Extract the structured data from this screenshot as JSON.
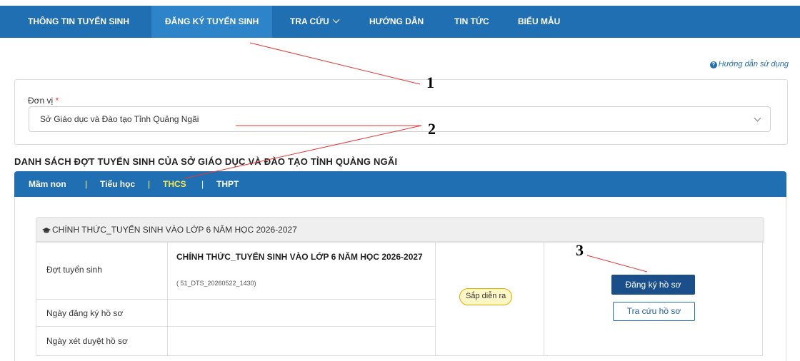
{
  "topnav": {
    "items": [
      {
        "label": "THÔNG TIN TUYỂN SINH"
      },
      {
        "label": "ĐĂNG KÝ TUYỂN SINH"
      },
      {
        "label": "TRA CỨU"
      },
      {
        "label": "HƯỚNG DẪN"
      },
      {
        "label": "TIN TỨC"
      },
      {
        "label": "BIỂU MẪU"
      }
    ]
  },
  "help_link": {
    "label": "Hướng dẫn sử dụng"
  },
  "unit": {
    "label": "Đơn vị",
    "required_mark": "*",
    "value": "Sở Giáo dục và Đào tạo Tỉnh Quảng Ngãi"
  },
  "list_title": "DANH SÁCH ĐỢT TUYỂN SINH CỦA SỞ GIÁO DỤC VÀ ĐÀO TẠO TỈNH QUẢNG NGÃI",
  "levels": {
    "items": [
      {
        "label": "Mầm non"
      },
      {
        "label": "Tiểu học"
      },
      {
        "label": "THCS"
      },
      {
        "label": "THPT"
      }
    ],
    "separator": "|"
  },
  "round": {
    "header": "CHÍNH THỨC_TUYỂN SINH VÀO LỚP 6 NĂM HỌC 2026-2027",
    "labels": {
      "round": "Đợt tuyển sinh",
      "register_date": "Ngày đăng ký hồ sơ",
      "review_date": "Ngày xét duyệt hồ sơ"
    },
    "name": "CHÍNH THỨC_TUYỂN SINH VÀO LỚP 6 NĂM HỌC 2026-2027",
    "code": "( 51_DTS_20260522_1430)",
    "status": "Sắp diễn ra",
    "register_button": "Đăng ký hồ sơ",
    "lookup_button": "Tra cứu hồ sơ"
  },
  "annotations": {
    "n1": "1",
    "n2": "2",
    "n3": "3"
  },
  "colors": {
    "nav_bg": "#1f6fb2",
    "nav_active": "#2d84c8",
    "active_level": "#f6e84a",
    "primary_button": "#1b4f8a",
    "badge_border": "#e7a900",
    "annotation_line": "#e53935"
  },
  "icons": {
    "help": "question-circle-icon",
    "cap": "graduation-cap-icon",
    "chevron": "chevron-down-icon"
  }
}
